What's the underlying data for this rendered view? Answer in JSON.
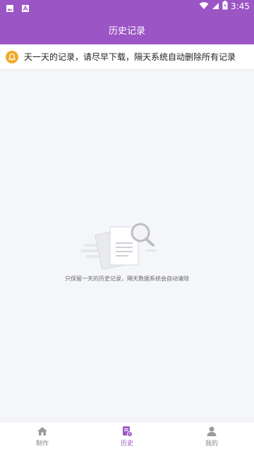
{
  "status_bar": {
    "time": "3:45"
  },
  "header": {
    "title": "历史记录"
  },
  "notice": {
    "text": "天一天的记录，请尽早下载，隔天系统自动删除所有记录"
  },
  "empty_state": {
    "text": "只保留一天的历史记录，隔天数据系统会自动清除"
  },
  "tabbar": {
    "items": [
      {
        "label": "制作",
        "icon": "home-icon",
        "active": false
      },
      {
        "label": "历史",
        "icon": "history-icon",
        "active": true
      },
      {
        "label": "我的",
        "icon": "user-icon",
        "active": false
      }
    ]
  },
  "colors": {
    "primary": "#9c55c5",
    "notice_icon": "#f1a92a",
    "background": "#f5f6fa"
  }
}
